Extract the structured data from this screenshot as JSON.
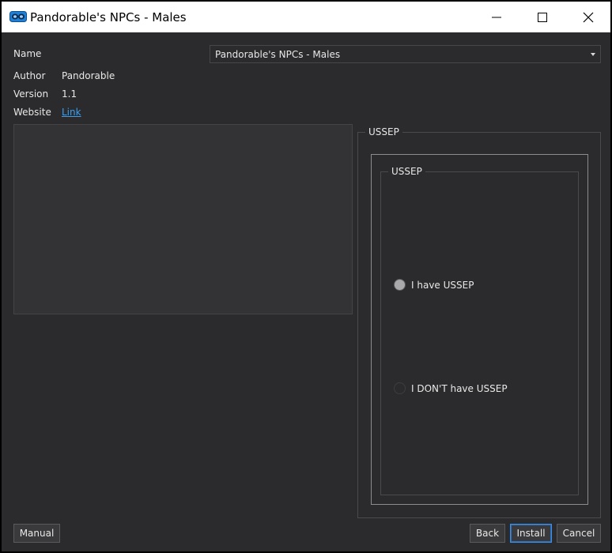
{
  "window": {
    "title": "Pandorable's NPCs - Males",
    "controls": {
      "minimize": "minimize",
      "maximize": "maximize",
      "close": "close"
    }
  },
  "info": {
    "name_label": "Name",
    "name_value": "Pandorable's NPCs - Males",
    "author_label": "Author",
    "author_value": "Pandorable",
    "version_label": "Version",
    "version_value": "1.1",
    "website_label": "Website",
    "website_link": "Link"
  },
  "options": {
    "outer_group_title": "USSEP",
    "inner_group_title": "USSEP",
    "choices": [
      {
        "label": "I have USSEP",
        "selected": true
      },
      {
        "label": "I DON'T have USSEP",
        "selected": false
      }
    ]
  },
  "buttons": {
    "manual": "Manual",
    "back": "Back",
    "install": "Install",
    "cancel": "Cancel"
  },
  "colors": {
    "background": "#2b2b2d",
    "link": "#3aa0f0",
    "accent": "#3a8ee6",
    "app_icon": "#1e7fd6"
  }
}
